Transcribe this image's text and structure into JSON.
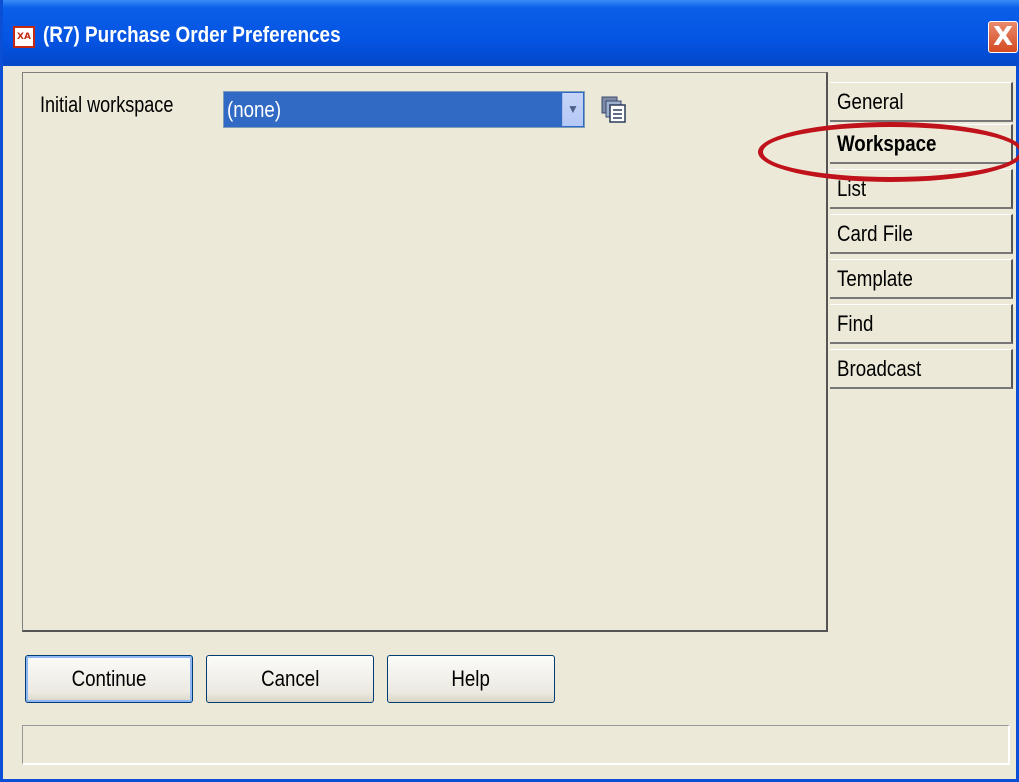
{
  "window": {
    "title": "(R7) Purchase Order Preferences",
    "app_icon_text": "XA",
    "close_label": "X"
  },
  "workspace": {
    "label": "Initial workspace",
    "selected_value": "(none)",
    "dropdown_arrow": "chevron-down-icon",
    "lookup_icon": "lookup-list-icon"
  },
  "tabs": [
    {
      "label": "General",
      "active": false
    },
    {
      "label": "Workspace",
      "active": true
    },
    {
      "label": "List",
      "active": false
    },
    {
      "label": "Card File",
      "active": false
    },
    {
      "label": "Template",
      "active": false
    },
    {
      "label": "Find",
      "active": false
    },
    {
      "label": "Broadcast",
      "active": false
    }
  ],
  "buttons": {
    "continue": "Continue",
    "cancel": "Cancel",
    "help": "Help"
  },
  "status": {
    "text": ""
  },
  "colors": {
    "titlebar": "#0554e3",
    "selection": "#316ac5",
    "highlight": "#c0121b"
  }
}
